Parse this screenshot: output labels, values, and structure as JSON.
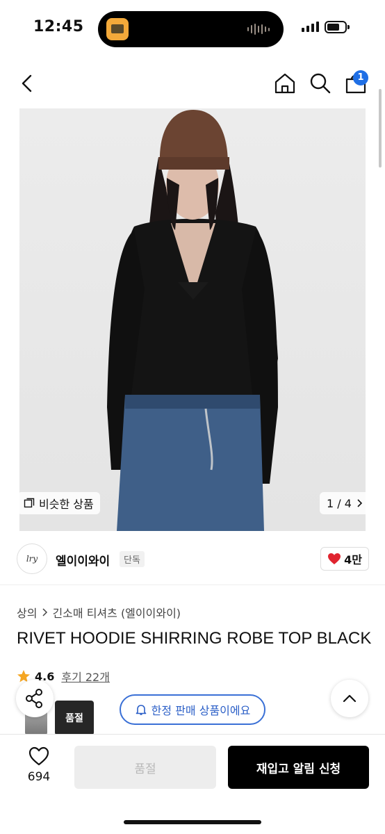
{
  "status_bar": {
    "time": "12:45"
  },
  "nav": {
    "cart_count": "1"
  },
  "hero": {
    "similar_label": "비슷한 상품",
    "pager": "1 / 4"
  },
  "seller": {
    "logo_text": "lry",
    "name": "엘이이와이",
    "tag": "단독",
    "likes": "4만"
  },
  "product": {
    "breadcrumb": [
      "상의",
      "긴소매 티셔츠 (엘이이와이)"
    ],
    "title": "RIVET HOODIE SHIRRING ROBE TOP BLACK",
    "rating": "4.6",
    "reviews": "후기 22개",
    "limited_label": "한정 판매 상품이에요",
    "thumb_label": "품절"
  },
  "bottom": {
    "wish_count": "694",
    "sold_out_label": "품절",
    "restock_label": "재입고 알림 신청"
  },
  "colors": {
    "accent_blue": "#1f6fe5",
    "heart_red": "#e0242f",
    "star": "#f5a623"
  }
}
